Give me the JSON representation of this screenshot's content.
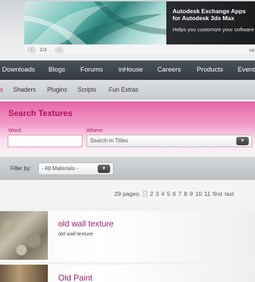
{
  "banner": {
    "title": "Autodesk Exchange Apps for Autodesk 3ds Max",
    "subtitle": "Helps you customize your software",
    "page_indicator": "1/3",
    "prev_glyph": "‹",
    "next_glyph": "›",
    "right_text": "Hi"
  },
  "main_nav": [
    "Downloads",
    "Blogs",
    "Forums",
    "inHouse",
    "Careers",
    "Products",
    "Events"
  ],
  "sub_nav": [
    "s",
    "Shaders",
    "Plugins",
    "Scripts",
    "Fun Extras"
  ],
  "search": {
    "title": "Search Textures",
    "word_label": "Word:",
    "word_value": "",
    "where_label": "Where:",
    "where_value": "Search in Titles"
  },
  "filter": {
    "label": "Filter by:",
    "value": "- All Materials -"
  },
  "pagination": {
    "label": "29 pages:",
    "pages": [
      "1",
      "2",
      "3",
      "4",
      "5",
      "6",
      "7",
      "8",
      "9",
      "10",
      "11"
    ],
    "current": "1",
    "first": "first",
    "last": "last"
  },
  "results": [
    {
      "title": "old wall texture",
      "description": "old wall texture"
    },
    {
      "title": "Old Paint",
      "description": ""
    }
  ],
  "colors": {
    "accent": "#b5105e",
    "nav_bg": "#3f464b",
    "link": "#9b1f6c"
  }
}
